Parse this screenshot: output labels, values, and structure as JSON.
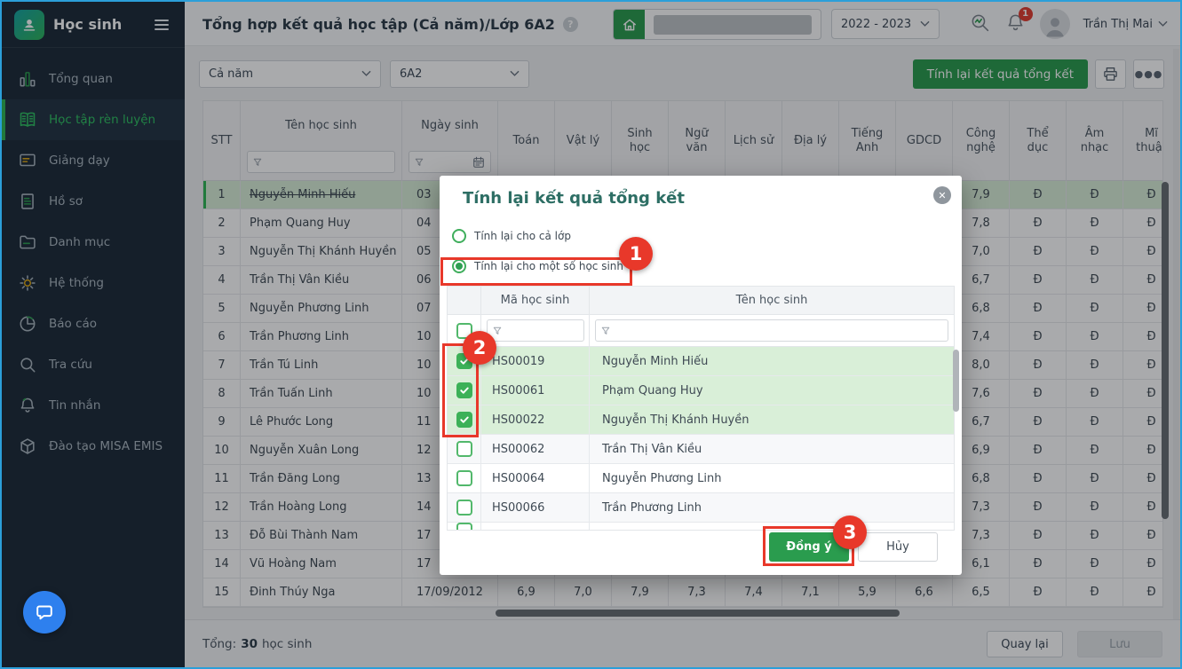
{
  "colors": {
    "accent_green": "#2a9c4e",
    "checked_green": "#3cb158",
    "annotation_red": "#e8382a",
    "sidebar_bg": "#1c2a38",
    "window_border": "#2b9fd9",
    "highlight_green": "#d9efd8",
    "modal_title": "#2d6e64",
    "chat_blue": "#2e80ee"
  },
  "sidebar": {
    "app_title": "Học sinh",
    "items": [
      {
        "label": "Tổng quan",
        "icon": "bar-chart-icon",
        "active": false
      },
      {
        "label": "Học tập rèn luyện",
        "icon": "open-book-icon",
        "active": true
      },
      {
        "label": "Giảng dạy",
        "icon": "presentation-icon",
        "active": false
      },
      {
        "label": "Hồ sơ",
        "icon": "document-icon",
        "active": false
      },
      {
        "label": "Danh mục",
        "icon": "folder-icon",
        "active": false
      },
      {
        "label": "Hệ thống",
        "icon": "gear-icon",
        "active": false
      },
      {
        "label": "Báo cáo",
        "icon": "pie-chart-icon",
        "active": false
      },
      {
        "label": "Tra cứu",
        "icon": "search-icon",
        "active": false
      },
      {
        "label": "Tin nhắn",
        "icon": "bell-icon",
        "active": false
      },
      {
        "label": "Đào tạo MISA EMIS",
        "icon": "cube-icon",
        "active": false
      }
    ]
  },
  "header": {
    "title": "Tổng hợp kết quả học tập (Cả năm)/Lớp 6A2",
    "help_glyph": "?",
    "school_year": "2022 - 2023",
    "notification_count": "1",
    "user_name": "Trần Thị Mai"
  },
  "toolbar": {
    "semester_filter": "Cả năm",
    "class_filter": "6A2",
    "recalculate_button": "Tính lại kết quả tổng kết",
    "more_glyph": "●●●"
  },
  "table": {
    "columns": [
      "STT",
      "Tên học sinh",
      "Ngày sinh",
      "Toán",
      "Vật lý",
      "Sinh học",
      "Ngữ văn",
      "Lịch sử",
      "Địa lý",
      "Tiếng Anh",
      "GDCD",
      "Công nghệ",
      "Thể dục",
      "Âm nhạc",
      "Mĩ thuật"
    ],
    "rows": [
      {
        "stt": "1",
        "name": "Nguyễn Minh Hiếu",
        "dob": "03",
        "highlight": true,
        "strikethrough": true,
        "scores": [
          "",
          "",
          "",
          "",
          "",
          "",
          "",
          "",
          "7,9",
          "Đ",
          "Đ",
          "Đ"
        ]
      },
      {
        "stt": "2",
        "name": "Phạm Quang Huy",
        "dob": "04",
        "highlight": false,
        "strikethrough": false,
        "scores": [
          "",
          "",
          "",
          "",
          "",
          "",
          "",
          "",
          "7,8",
          "Đ",
          "Đ",
          "Đ"
        ]
      },
      {
        "stt": "3",
        "name": "Nguyễn Thị Khánh Huyền",
        "dob": "05",
        "highlight": false,
        "strikethrough": false,
        "scores": [
          "",
          "",
          "",
          "",
          "",
          "",
          "",
          "",
          "7,0",
          "Đ",
          "Đ",
          "Đ"
        ]
      },
      {
        "stt": "4",
        "name": "Trần Thị Vân Kiều",
        "dob": "06",
        "highlight": false,
        "strikethrough": false,
        "scores": [
          "",
          "",
          "",
          "",
          "",
          "",
          "",
          "",
          "6,7",
          "Đ",
          "Đ",
          "Đ"
        ]
      },
      {
        "stt": "5",
        "name": "Nguyễn Phương Linh",
        "dob": "07",
        "highlight": false,
        "strikethrough": false,
        "scores": [
          "",
          "",
          "",
          "",
          "",
          "",
          "",
          "",
          "6,8",
          "Đ",
          "Đ",
          "Đ"
        ]
      },
      {
        "stt": "6",
        "name": "Trần Phương Linh",
        "dob": "10",
        "highlight": false,
        "strikethrough": false,
        "scores": [
          "",
          "",
          "",
          "",
          "",
          "",
          "",
          "",
          "7,4",
          "Đ",
          "Đ",
          "Đ"
        ]
      },
      {
        "stt": "7",
        "name": "Trần Tú Linh",
        "dob": "10",
        "highlight": false,
        "strikethrough": false,
        "scores": [
          "",
          "",
          "",
          "",
          "",
          "",
          "",
          "",
          "8,0",
          "Đ",
          "Đ",
          "Đ"
        ]
      },
      {
        "stt": "8",
        "name": "Trần Tuấn Linh",
        "dob": "10",
        "highlight": false,
        "strikethrough": false,
        "scores": [
          "",
          "",
          "",
          "",
          "",
          "",
          "",
          "",
          "7,6",
          "Đ",
          "Đ",
          "Đ"
        ]
      },
      {
        "stt": "9",
        "name": "Lê Phước Long",
        "dob": "11",
        "highlight": false,
        "strikethrough": false,
        "scores": [
          "",
          "",
          "",
          "",
          "",
          "",
          "",
          "",
          "6,7",
          "Đ",
          "Đ",
          "Đ"
        ]
      },
      {
        "stt": "10",
        "name": "Nguyễn Xuân Long",
        "dob": "12",
        "highlight": false,
        "strikethrough": false,
        "scores": [
          "",
          "",
          "",
          "",
          "",
          "",
          "",
          "",
          "6,9",
          "Đ",
          "Đ",
          "Đ"
        ]
      },
      {
        "stt": "11",
        "name": "Trần Đăng Long",
        "dob": "13",
        "highlight": false,
        "strikethrough": false,
        "scores": [
          "",
          "",
          "",
          "",
          "",
          "",
          "",
          "",
          "6,8",
          "Đ",
          "Đ",
          "Đ"
        ]
      },
      {
        "stt": "12",
        "name": "Trần Hoàng Long",
        "dob": "14",
        "highlight": false,
        "strikethrough": false,
        "scores": [
          "",
          "",
          "",
          "",
          "",
          "",
          "",
          "",
          "7,3",
          "Đ",
          "Đ",
          "Đ"
        ]
      },
      {
        "stt": "13",
        "name": "Đỗ Bùi Thành Nam",
        "dob": "17",
        "highlight": false,
        "strikethrough": false,
        "scores": [
          "",
          "",
          "",
          "",
          "",
          "",
          "",
          "",
          "7,3",
          "Đ",
          "Đ",
          "Đ"
        ]
      },
      {
        "stt": "14",
        "name": "Vũ Hoàng Nam",
        "dob": "17",
        "highlight": false,
        "strikethrough": false,
        "scores": [
          "",
          "",
          "",
          "",
          "",
          "",
          "",
          "",
          "6,1",
          "Đ",
          "Đ",
          "Đ"
        ]
      },
      {
        "stt": "15",
        "name": "Đinh Thúy Nga",
        "dob": "17/09/2012",
        "highlight": false,
        "strikethrough": false,
        "scores": [
          "6,9",
          "7,0",
          "7,9",
          "7,3",
          "7,4",
          "7,1",
          "5,9",
          "6,6",
          "6,5",
          "Đ",
          "Đ",
          "Đ"
        ]
      }
    ]
  },
  "footer": {
    "total_label": "Tổng:",
    "total_value": "30",
    "total_suffix": "học sinh",
    "back_button": "Quay lại",
    "save_button": "Lưu"
  },
  "modal": {
    "title": "Tính lại kết quả tổng kết",
    "close_glyph": "✕",
    "radio_all": "Tính lại cho cả lớp",
    "radio_some": "Tính lại cho một số học sinh",
    "columns": [
      "Mã học sinh",
      "Tên học sinh"
    ],
    "students": [
      {
        "code": "HS00019",
        "name": "Nguyễn Minh Hiếu",
        "checked": true
      },
      {
        "code": "HS00061",
        "name": "Phạm Quang Huy",
        "checked": true
      },
      {
        "code": "HS00022",
        "name": "Nguyễn Thị Khánh Huyền",
        "checked": true
      },
      {
        "code": "HS00062",
        "name": "Trần Thị Vân Kiều",
        "checked": false
      },
      {
        "code": "HS00064",
        "name": "Nguyễn Phương Linh",
        "checked": false
      },
      {
        "code": "HS00066",
        "name": "Trần Phương Linh",
        "checked": false
      }
    ],
    "confirm_button": "Đồng ý",
    "cancel_button": "Hủy"
  },
  "annotations": {
    "step1": "1",
    "step2": "2",
    "step3": "3"
  }
}
